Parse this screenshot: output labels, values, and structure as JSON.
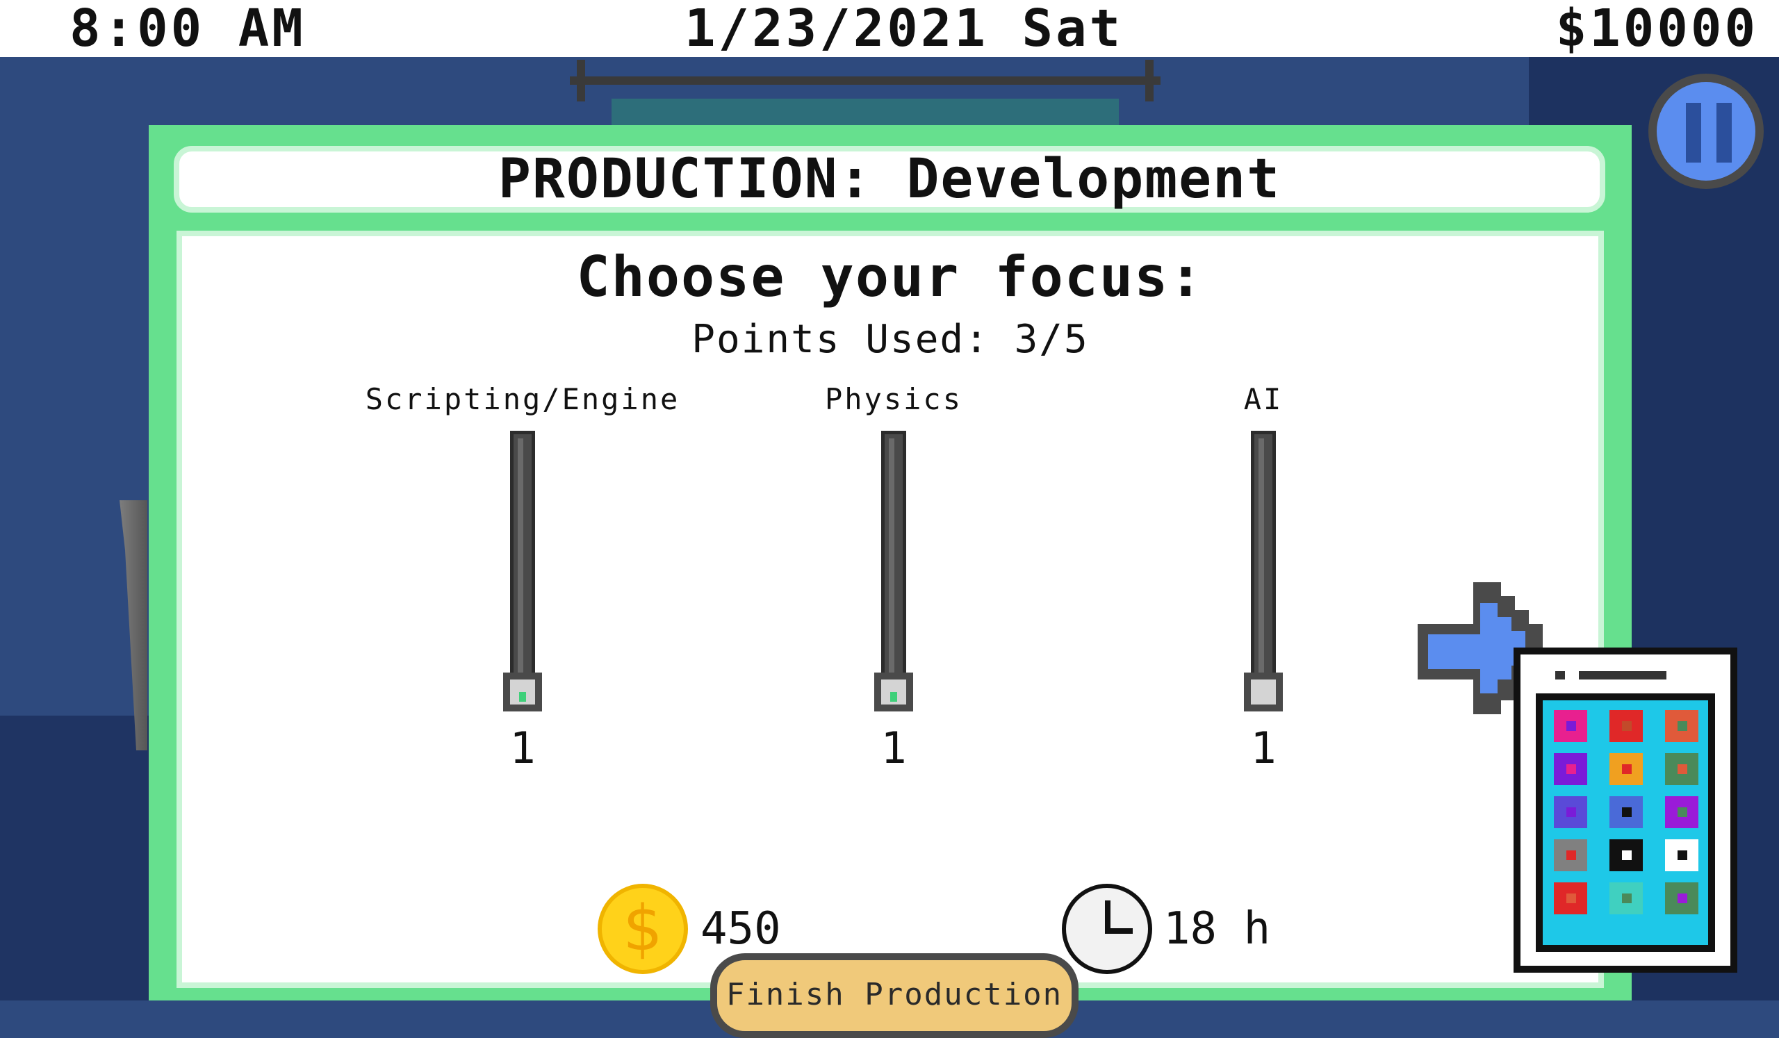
{
  "hud": {
    "time": "8:00 AM",
    "date": "1/23/2021 Sat",
    "money": "$10000"
  },
  "panel": {
    "title": "PRODUCTION: Development",
    "heading": "Choose your focus:",
    "points_used": "Points Used: 3/5",
    "sliders": [
      {
        "label": "Scripting/Engine",
        "value": "1",
        "level": 1
      },
      {
        "label": "Physics",
        "value": "1",
        "level": 1
      },
      {
        "label": "AI",
        "value": "1",
        "level": 1
      }
    ],
    "cost": "450",
    "duration": "18 h",
    "finish_label": "Finish Production"
  },
  "icons": {
    "pause": "pause-icon",
    "next": "arrow-right-icon",
    "coin": "dollar-coin-icon",
    "clock": "clock-icon",
    "phone": "phone-icon"
  },
  "colors": {
    "panel_green": "#66e08e",
    "arrow_blue": "#5b8def",
    "button_gold": "#f0c97a",
    "coin_yellow": "#ffd21a"
  },
  "phone_apps": [
    {
      "bg": "#e8208f",
      "dot": "#7a1bd8"
    },
    {
      "bg": "#e02828",
      "dot": "#c24a2a"
    },
    {
      "bg": "#e05a3a",
      "dot": "#4a8a5a"
    },
    {
      "bg": "#7a1bd8",
      "dot": "#e8208f"
    },
    {
      "bg": "#f0a020",
      "dot": "#e02828"
    },
    {
      "bg": "#4a8a5a",
      "dot": "#e05a3a"
    },
    {
      "bg": "#5a4ad8",
      "dot": "#7a1bd8"
    },
    {
      "bg": "#4a6ad8",
      "dot": "#111111"
    },
    {
      "bg": "#9a1bd8",
      "dot": "#4a8a5a"
    },
    {
      "bg": "#808080",
      "dot": "#e02828"
    },
    {
      "bg": "#111111",
      "dot": "#ffffff"
    },
    {
      "bg": "#ffffff",
      "dot": "#111111"
    },
    {
      "bg": "#e02828",
      "dot": "#e05a3a"
    },
    {
      "bg": "#40d0c0",
      "dot": "#4a8a5a"
    },
    {
      "bg": "#4a8a5a",
      "dot": "#9a1bd8"
    }
  ]
}
